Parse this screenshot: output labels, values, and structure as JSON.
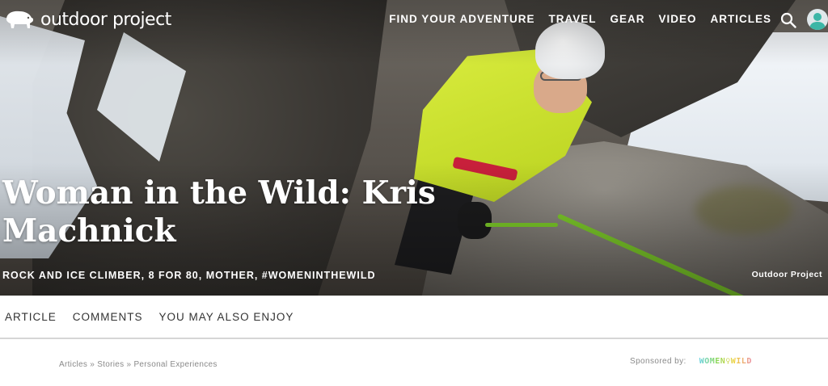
{
  "brand": {
    "name": "outdoor project"
  },
  "nav": {
    "links": [
      "FIND YOUR ADVENTURE",
      "TRAVEL",
      "GEAR",
      "VIDEO",
      "ARTICLES"
    ]
  },
  "hero": {
    "title": "Woman in the Wild: Kris Machnick",
    "subtitle": "ROCK AND ICE CLIMBER, 8 FOR 80, MOTHER, #WOMENINTHEWILD",
    "credit": "Outdoor Project"
  },
  "tabs": [
    "ARTICLE",
    "COMMENTS",
    "YOU MAY ALSO ENJOY"
  ],
  "breadcrumb": "Articles » Stories » Personal Experiences",
  "sponsor": {
    "label": "Sponsored by:",
    "logo_text": "WOMEN♀WILD"
  },
  "icons": {
    "logo": "bison-icon",
    "search": "search-icon",
    "user": "user-icon"
  },
  "colors": {
    "jacket": "#c9df2e",
    "rope": "#7fcf2a",
    "tab_border": "#d6d6d6"
  }
}
